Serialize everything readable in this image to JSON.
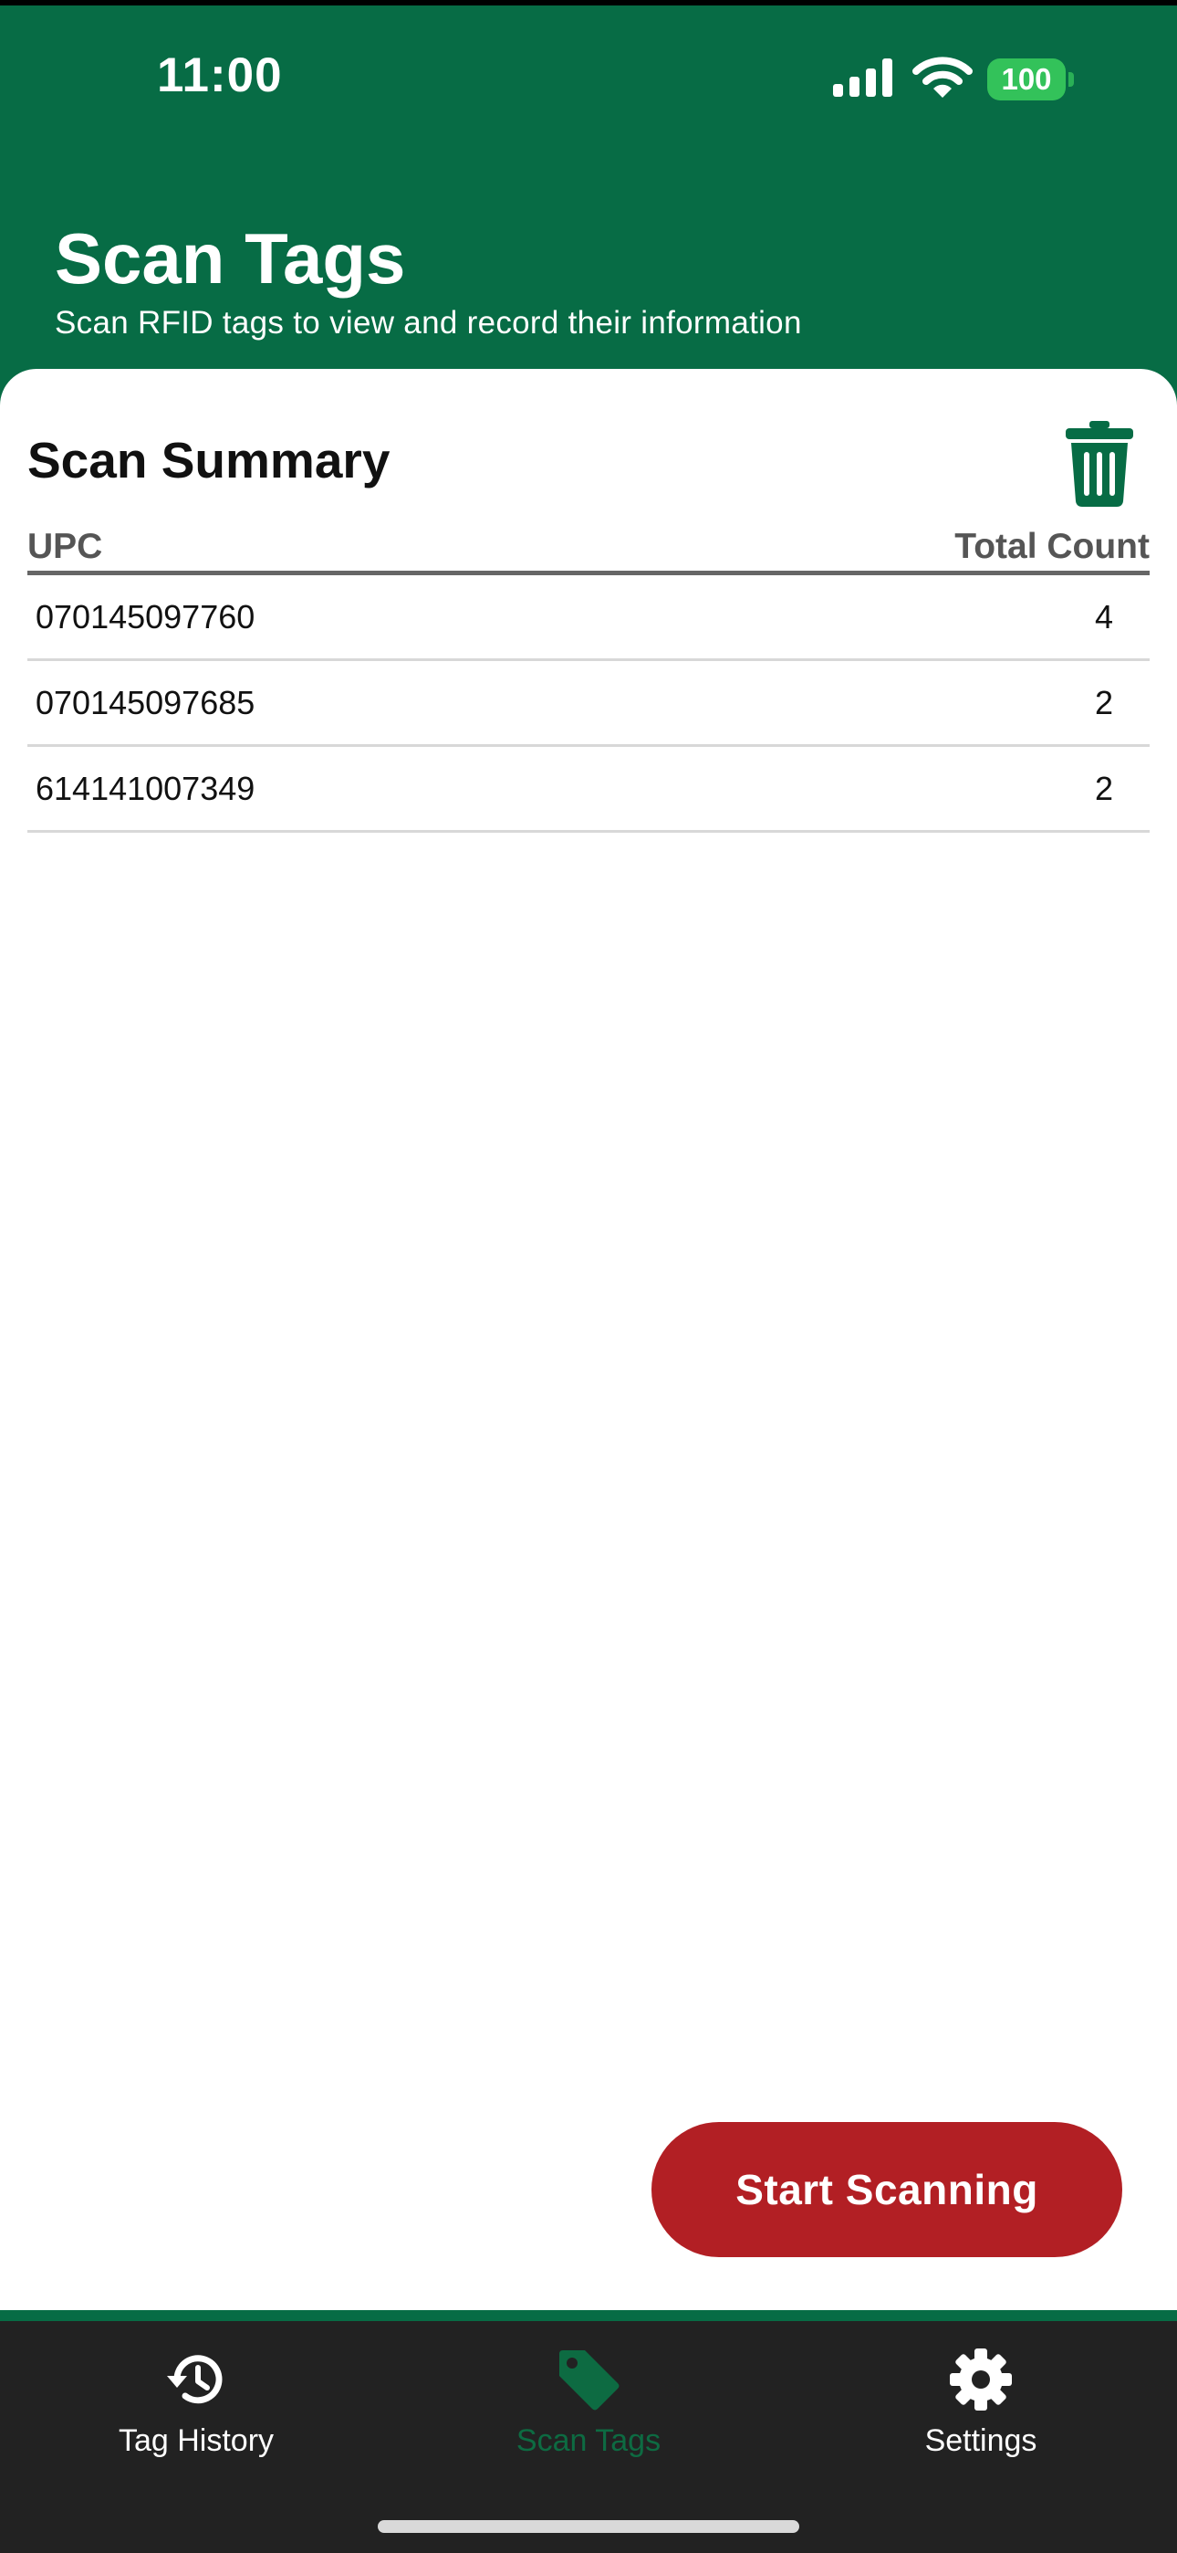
{
  "status_bar": {
    "time": "11:00",
    "battery": "100",
    "icons": [
      "signal-icon",
      "wifi-icon",
      "battery-icon"
    ]
  },
  "header": {
    "title": "Scan Tags",
    "subtitle": "Scan RFID tags to view and record their information"
  },
  "summary": {
    "title": "Scan Summary",
    "clear_icon": "trash-icon",
    "columns": [
      "UPC",
      "Total Count"
    ],
    "rows": [
      {
        "upc": "070145097760",
        "count": "4"
      },
      {
        "upc": "070145097685",
        "count": "2"
      },
      {
        "upc": "614141007349",
        "count": "2"
      }
    ]
  },
  "actions": {
    "start_label": "Start Scanning"
  },
  "nav": {
    "items": [
      {
        "label": "Tag History",
        "icon": "history-icon",
        "active": false
      },
      {
        "label": "Scan Tags",
        "icon": "tag-icon",
        "active": true
      },
      {
        "label": "Settings",
        "icon": "gear-icon",
        "active": false
      }
    ]
  },
  "colors": {
    "brand_green": "#076c45",
    "start_button": "#b21f24",
    "nav_background": "#222222",
    "battery_green": "#33c25a"
  }
}
